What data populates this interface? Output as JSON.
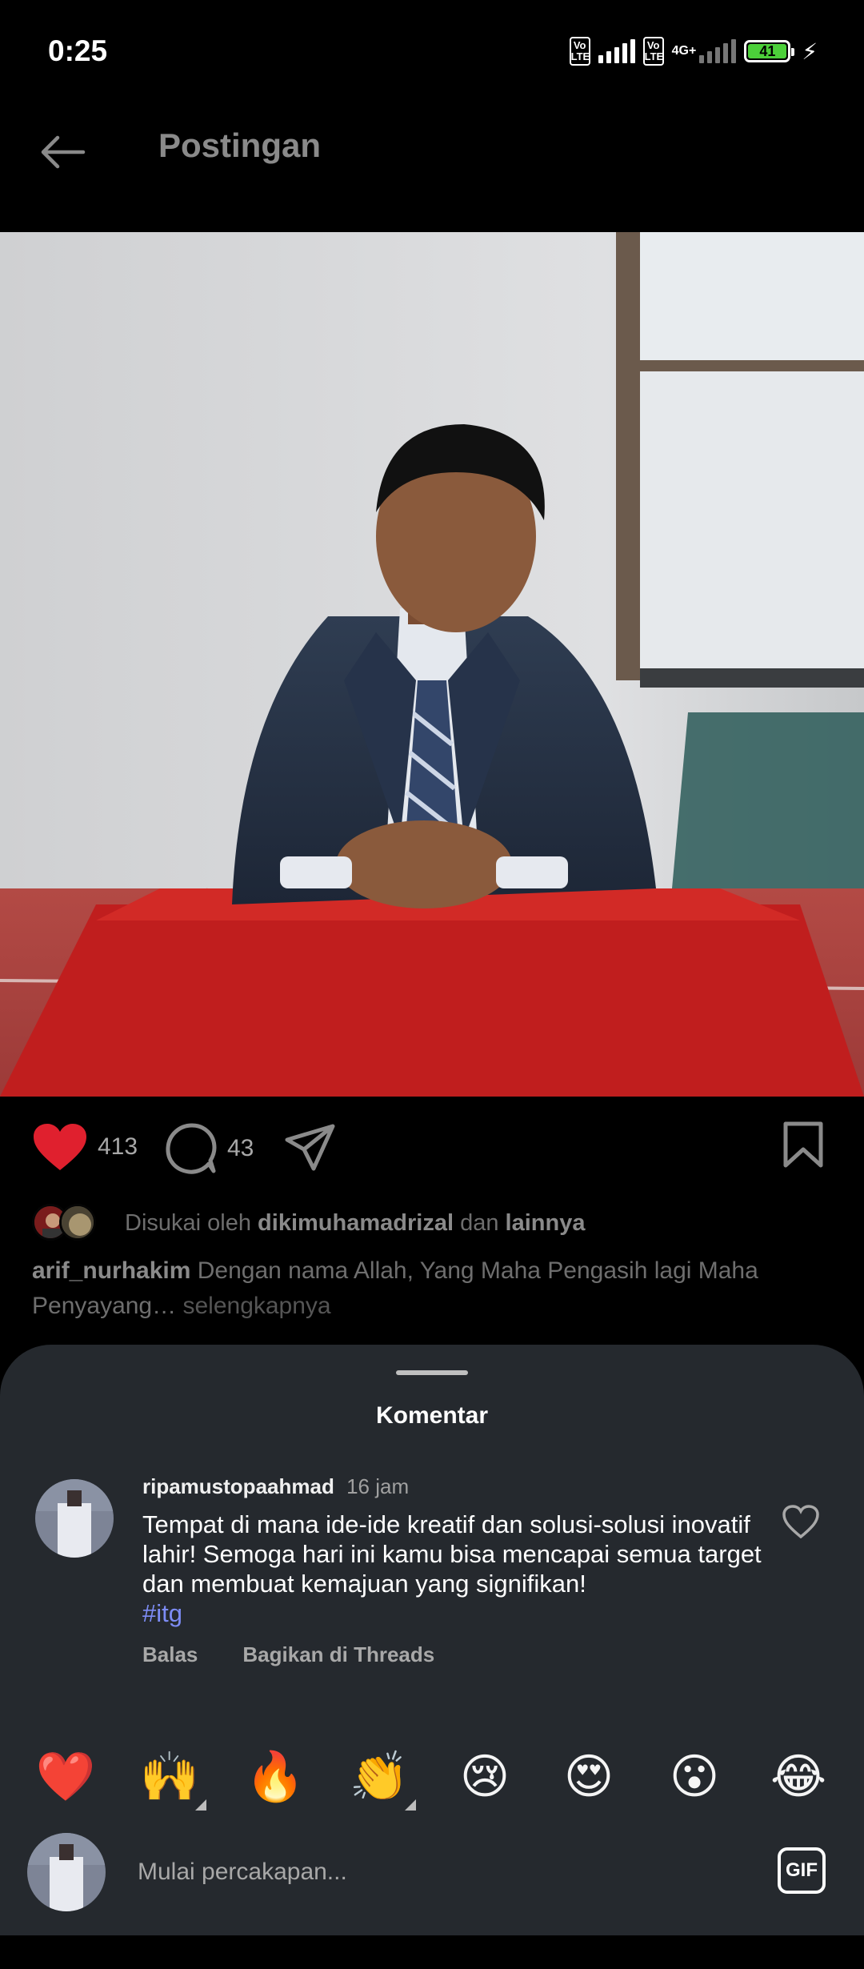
{
  "status_bar": {
    "time": "0:25",
    "volte1": "Vo LTE",
    "volte2": "Vo LTE",
    "network": "4G+",
    "battery": "41"
  },
  "header": {
    "title": "Postingan",
    "back_icon": "arrow-left-icon"
  },
  "post": {
    "like_count": "413",
    "comment_count": "43",
    "liked_by_prefix": "Disukai oleh",
    "liked_by_user": "dikimuhamadrizal",
    "liked_by_and": "dan",
    "liked_by_others": "lainnya",
    "caption_user": "arif_nurhakim",
    "caption_text": "Dengan nama Allah, Yang Maha Pengasih lagi Maha Penyayang…",
    "caption_more": "selengkapnya",
    "icons": [
      "heart-filled-icon",
      "comment-icon",
      "share-icon",
      "bookmark-icon"
    ],
    "like_color": "#e0202e"
  },
  "comments_sheet": {
    "title": "Komentar",
    "comment": {
      "user": "ripamustopaahmad",
      "time": "16 jam",
      "text": "Tempat di mana ide-ide kreatif dan solusi-solusi inovatif lahir! Semoga hari ini kamu bisa mencapai semua target dan membuat kemajuan yang signifikan!",
      "hashtag": "#itg",
      "reply_label": "Balas",
      "share_threads_label": "Bagikan di Threads"
    },
    "emojis": [
      "❤️",
      "🙌",
      "🔥",
      "👏",
      "😢",
      "😍",
      "😮",
      "😂"
    ],
    "composer_placeholder": "Mulai percakapan...",
    "gif_label": "GIF"
  }
}
